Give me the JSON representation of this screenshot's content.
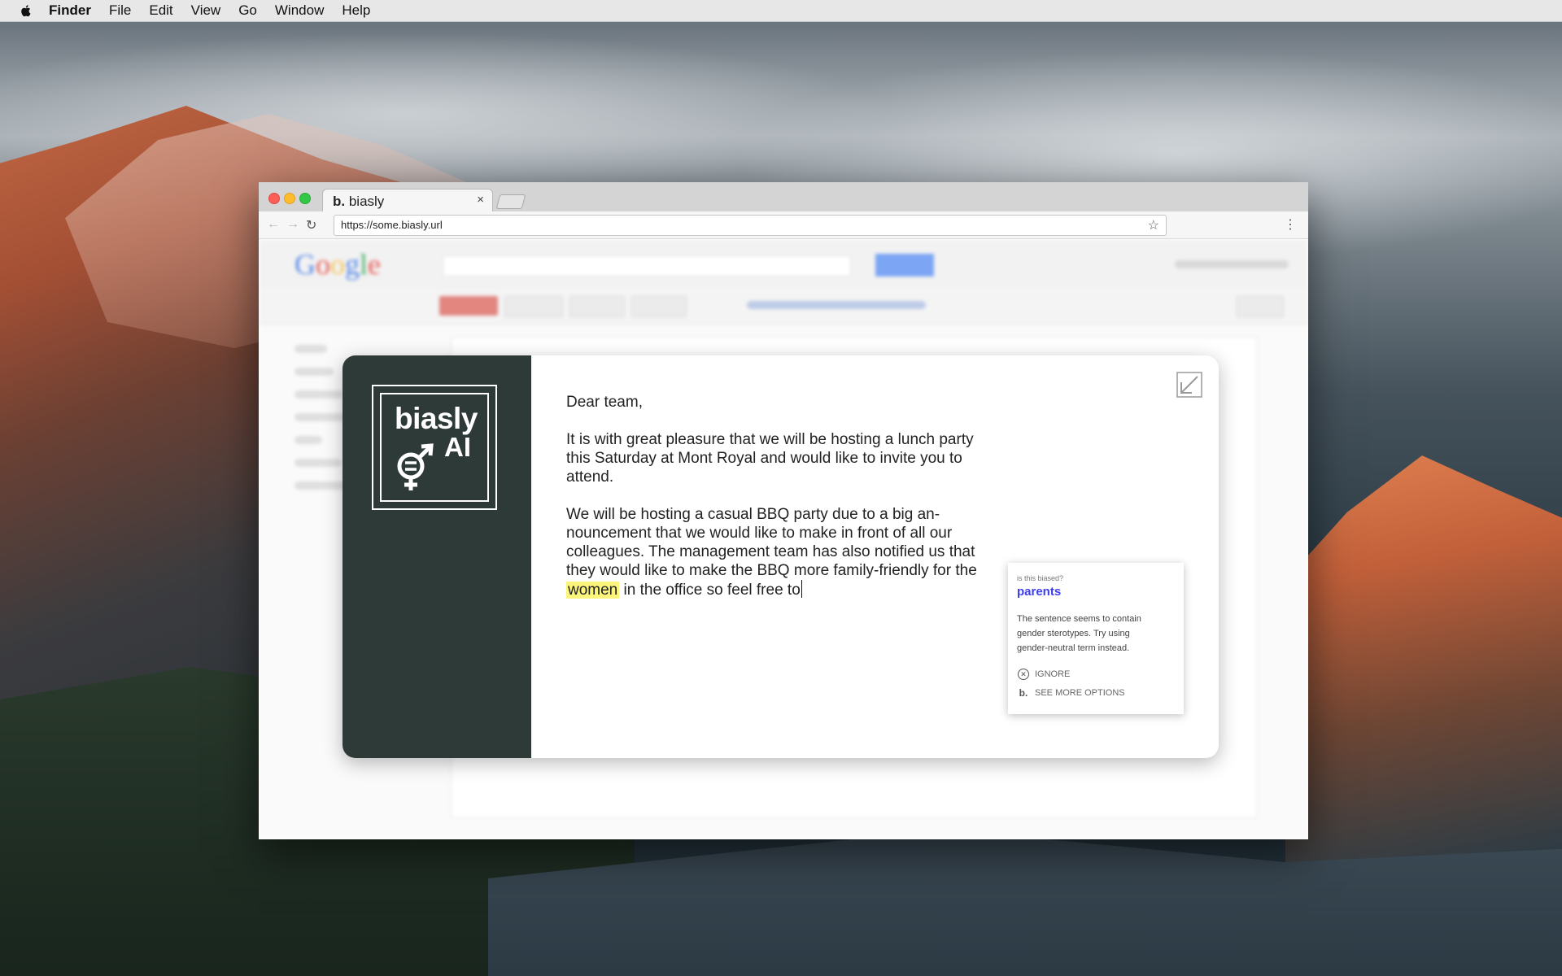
{
  "menubar": {
    "apple_icon": "apple-icon",
    "items": [
      "Finder",
      "File",
      "Edit",
      "View",
      "Go",
      "Window",
      "Help"
    ]
  },
  "browser": {
    "tab": {
      "brand": "b.",
      "title": "biasly",
      "close": "×"
    },
    "url": "https://some.biasly.url"
  },
  "modal": {
    "logo": {
      "line1": "biasly",
      "line2": "AI"
    },
    "email": {
      "greeting": "Dear team,",
      "paragraph1": "It is with great pleasure that we will be hosting a lunch party this Saturday at Mont Royal and would like to invite you to attend.",
      "paragraph2_before": "We will be hosting a casual BBQ party due to a big an-nouncement that we would like to make in front of all our colleagues. The management team has also notified us that they would like to make the BBQ more family-friendly for the",
      "highlighted_word": "women",
      "paragraph2_after": "in the office so feel free to"
    },
    "suggestion": {
      "question": "is this biased?",
      "word": "parents",
      "description": "The sentence seems to contain gender sterotypes. Try using gender-neutral term instead.",
      "ignore_label": "IGNORE",
      "more_label": "SEE MORE OPTIONS",
      "more_icon_text": "b."
    },
    "colors": {
      "sidebar": "#2e3a38",
      "highlight": "#fbf57c",
      "suggestion_word": "#3d3df0"
    }
  }
}
